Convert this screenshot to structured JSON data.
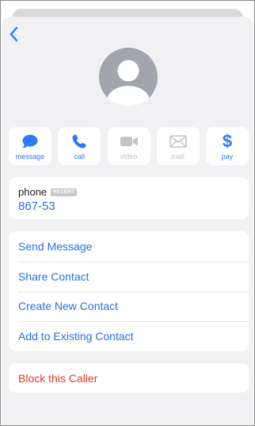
{
  "colors": {
    "accent": "#2b7cf3",
    "link": "#2b6fdb",
    "danger": "#e33a2c",
    "disabled": "#c4c4c8",
    "avatar_bg": "#a2a5ad",
    "sheet_bg": "#f1f1f4"
  },
  "header": {
    "back_icon": "chevron-left-icon"
  },
  "avatar": {
    "icon": "person-silhouette-icon"
  },
  "actions": [
    {
      "label": "message",
      "icon": "message-bubble-icon",
      "enabled": true
    },
    {
      "label": "call",
      "icon": "phone-icon",
      "enabled": true
    },
    {
      "label": "video",
      "icon": "video-camera-icon",
      "enabled": false
    },
    {
      "label": "mail",
      "icon": "envelope-icon",
      "enabled": false
    },
    {
      "label": "pay",
      "icon": "dollar-icon",
      "glyph": "$",
      "enabled": true
    }
  ],
  "phone": {
    "label": "phone",
    "badge": "RECENT",
    "number": "867-53"
  },
  "menu": {
    "items": [
      {
        "label": "Send Message"
      },
      {
        "label": "Share Contact"
      },
      {
        "label": "Create New Contact"
      },
      {
        "label": "Add to Existing Contact"
      }
    ]
  },
  "block": {
    "label": "Block this Caller"
  }
}
